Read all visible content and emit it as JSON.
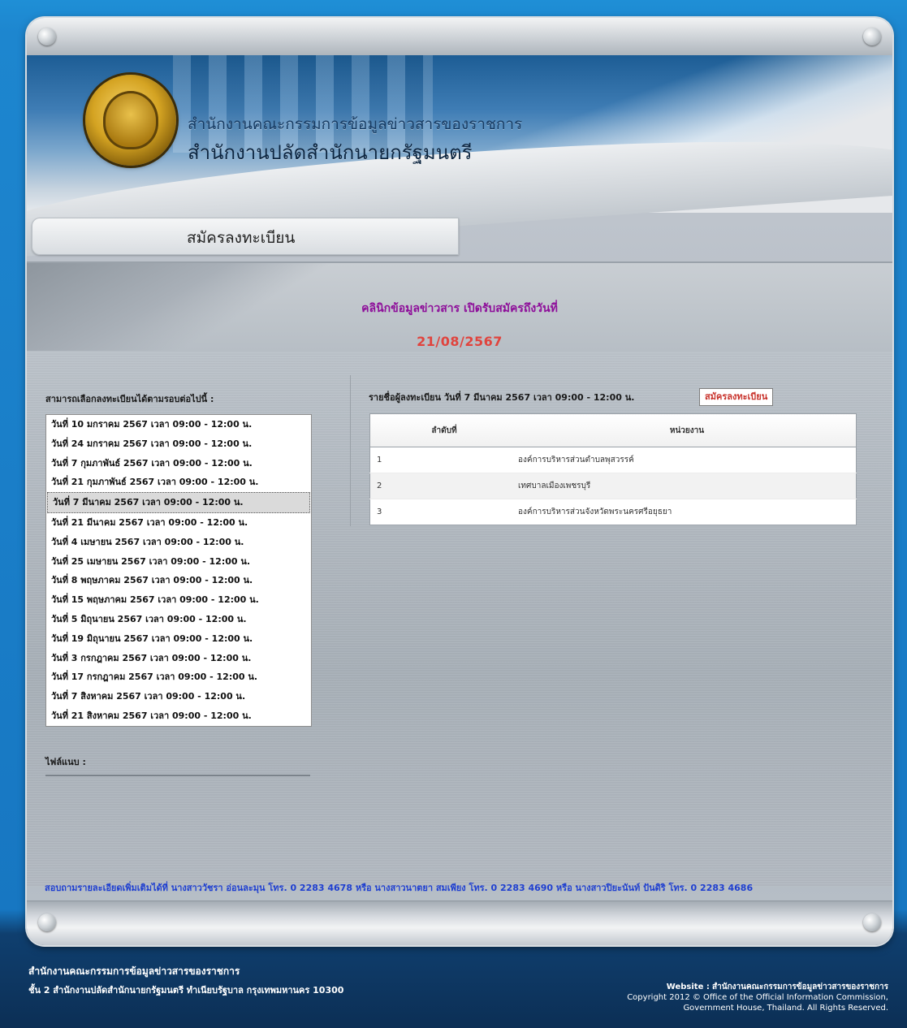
{
  "header": {
    "org_name": "สำนักงานคณะกรรมการข้อมูลข่าวสารของราชการ",
    "office_name": "สำนักงานปลัดสำนักนายกรัฐมนตรี"
  },
  "register_tab": {
    "label": "สมัครลงทะเบียน"
  },
  "notice": {
    "line1": "คลินิกข้อมูลข่าวสาร เปิดรับสมัครถึงวันที่",
    "date": "21/08/2567"
  },
  "rounds": {
    "heading": "สามารถเลือกลงทะเบียนได้ตามรอบต่อไปนี้ :",
    "selected_index": 4,
    "items": [
      "วันที่ 10 มกราคม 2567 เวลา 09:00 - 12:00 น.",
      "วันที่ 24 มกราคม 2567 เวลา 09:00 - 12:00 น.",
      "วันที่ 7 กุมภาพันธ์ 2567 เวลา 09:00 - 12:00 น.",
      "วันที่ 21 กุมภาพันธ์ 2567 เวลา 09:00 - 12:00 น.",
      "วันที่ 7 มีนาคม 2567 เวลา 09:00 - 12:00 น.",
      "วันที่ 21 มีนาคม 2567 เวลา 09:00 - 12:00 น.",
      "วันที่ 4 เมษายน 2567 เวลา 09:00 - 12:00 น.",
      "วันที่ 25 เมษายน 2567 เวลา 09:00 - 12:00 น.",
      "วันที่ 8 พฤษภาคม 2567 เวลา 09:00 - 12:00 น.",
      "วันที่ 15 พฤษภาคม 2567 เวลา 09:00 - 12:00 น.",
      "วันที่ 5 มิถุนายน 2567 เวลา 09:00 - 12:00 น.",
      "วันที่ 19 มิถุนายน 2567 เวลา 09:00 - 12:00 น.",
      "วันที่ 3 กรกฎาคม 2567 เวลา 09:00 - 12:00 น.",
      "วันที่ 17 กรกฎาคม 2567 เวลา 09:00 - 12:00 น.",
      "วันที่ 7 สิงหาคม 2567 เวลา 09:00 - 12:00 น.",
      "วันที่ 21 สิงหาคม 2567 เวลา 09:00 - 12:00 น."
    ]
  },
  "attachment": {
    "label": "ไฟล์แนบ :"
  },
  "registrants": {
    "heading": "รายชื่อผู้ลงทะเบียน วันที่ 7 มีนาคม 2567 เวลา 09:00 - 12:00 น.",
    "register_button": "สมัครลงทะเบียน",
    "columns": [
      "ลำดับที่",
      "หน่วยงาน"
    ],
    "rows": [
      [
        "1",
        "องค์การบริหารส่วนตำบลพุสวรรค์"
      ],
      [
        "2",
        "เทศบาลเมืองเพชรบุรี"
      ],
      [
        "3",
        "องค์การบริหารส่วนจังหวัดพระนครศรีอยุธยา"
      ]
    ]
  },
  "contact": {
    "text": "สอบถามรายละเอียดเพิ่มเติมได้ที่ นางสาววัชรา  อ่อนละมุน โทร. 0 2283 4678 หรือ นางสาวนาตยา สมเพียง โทร. 0 2283 4690 หรือ นางสาวปิยะนันท์ ปันดิริ โทร. 0 2283 4686"
  },
  "footer": {
    "org": "สำนักงานคณะกรรมการข้อมูลข่าวสารของราชการ",
    "address": "ชั้น 2 สำนักงานปลัดสำนักนายกรัฐมนตรี ทำเนียบรัฐบาล กรุงเทพมหานคร 10300",
    "website_label": "Website :",
    "website_value": "สำนักงานคณะกรรมการข้อมูลข่าวสารของราชการ",
    "copyright1": "Copyright 2012 © Office of the Official Information Commission,",
    "copyright2": "Government House, Thailand.  All Rights Reserved."
  }
}
